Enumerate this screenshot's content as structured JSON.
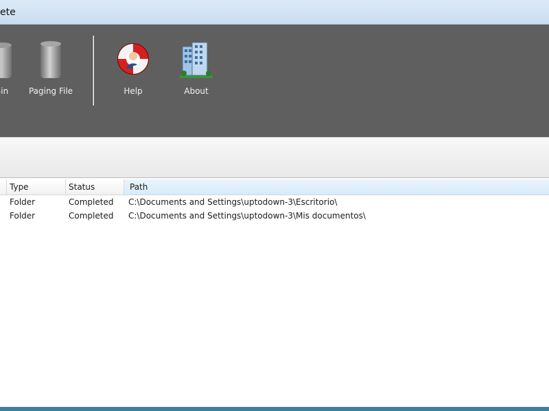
{
  "window": {
    "title_partial": "ete"
  },
  "toolbar": {
    "items": [
      {
        "label": "Bin",
        "icon": "recycle-bin-icon"
      },
      {
        "label": "Paging File",
        "icon": "paging-file-cylinder-icon"
      },
      {
        "label": "Help",
        "icon": "lifebuoy-help-icon"
      },
      {
        "label": "About",
        "icon": "building-about-icon"
      }
    ]
  },
  "table": {
    "columns": {
      "type": "Type",
      "status": "Status",
      "path": "Path"
    },
    "rows": [
      {
        "type": "Folder",
        "status": "Completed",
        "path": "C:\\Documents and Settings\\uptodown-3\\Escritorio\\"
      },
      {
        "type": "Folder",
        "status": "Completed",
        "path": "C:\\Documents and Settings\\uptodown-3\\Mis documentos\\"
      }
    ]
  },
  "colors": {
    "toolbar_bg": "#5f5f5f",
    "path_header_highlight": "#d6ebf9",
    "bottom_accent": "#3f7f99"
  }
}
